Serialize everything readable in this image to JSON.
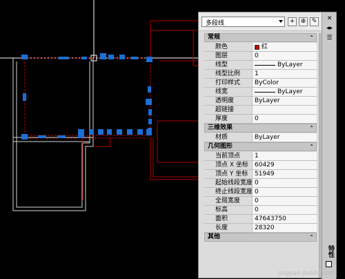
{
  "toolbar": {
    "object_type": "多段线",
    "btn_toggle_pickadd": "+",
    "btn_select_objects": "⊕",
    "btn_quick_select": "✎"
  },
  "sections": [
    {
      "title": "常规",
      "rows": [
        {
          "k": "颜色",
          "v": "红",
          "swatch": "#c00000"
        },
        {
          "k": "图层",
          "v": "0"
        },
        {
          "k": "线型",
          "v": "ByLayer",
          "line": true
        },
        {
          "k": "线型比例",
          "v": "1"
        },
        {
          "k": "打印样式",
          "v": "ByColor"
        },
        {
          "k": "线宽",
          "v": "ByLayer",
          "line": true
        },
        {
          "k": "透明度",
          "v": "ByLayer"
        },
        {
          "k": "超链接",
          "v": ""
        },
        {
          "k": "厚度",
          "v": "0"
        }
      ]
    },
    {
      "title": "三维效果",
      "rows": [
        {
          "k": "材质",
          "v": "ByLayer"
        }
      ]
    },
    {
      "title": "几何图形",
      "rows": [
        {
          "k": "当前顶点",
          "v": "1"
        },
        {
          "k": "顶点 X 坐标",
          "v": "60429"
        },
        {
          "k": "顶点 Y 坐标",
          "v": "51949"
        },
        {
          "k": "起始线段宽度",
          "v": "0"
        },
        {
          "k": "终止线段宽度",
          "v": "0"
        },
        {
          "k": "全局宽度",
          "v": "0"
        },
        {
          "k": "标高",
          "v": "0"
        },
        {
          "k": "面积",
          "v": "47643750"
        },
        {
          "k": "长度",
          "v": "28320"
        }
      ]
    },
    {
      "title": "其他",
      "rows": []
    }
  ],
  "side": {
    "title": "特性",
    "icons": [
      "close-icon",
      "autohide-icon",
      "menu-icon"
    ]
  },
  "watermark": "jingyan.baidu.com",
  "colors": {
    "grip": "#1c6fd6",
    "polyline": "#c00000",
    "wall": "#ffffff"
  }
}
